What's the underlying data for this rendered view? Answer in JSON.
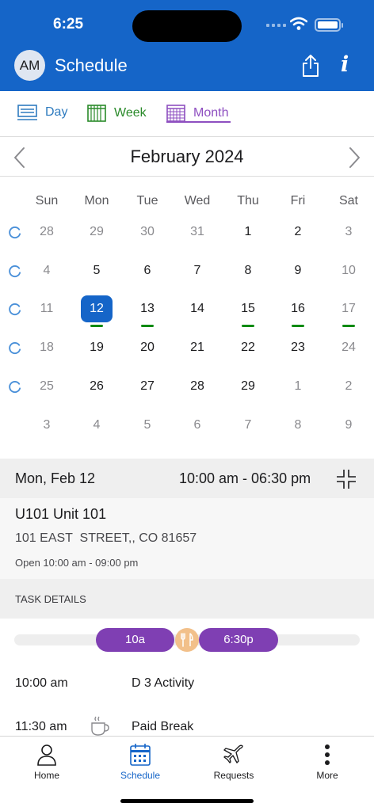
{
  "status_bar": {
    "time": "6:25"
  },
  "header": {
    "avatar_initials": "AM",
    "title": "Schedule"
  },
  "view_tabs": [
    {
      "label": "Day",
      "color": "#2e7bbf"
    },
    {
      "label": "Week",
      "color": "#2a8a2a"
    },
    {
      "label": "Month",
      "color": "#8e4fc0",
      "selected": true
    }
  ],
  "calendar": {
    "month_title": "February 2024",
    "weekdays": [
      "Sun",
      "Mon",
      "Tue",
      "Wed",
      "Thu",
      "Fri",
      "Sat"
    ],
    "weeks": [
      [
        {
          "d": "28",
          "dim": true
        },
        {
          "d": "29",
          "dim": true
        },
        {
          "d": "30",
          "dim": true
        },
        {
          "d": "31",
          "dim": true
        },
        {
          "d": "1"
        },
        {
          "d": "2"
        },
        {
          "d": "3",
          "dim": true
        }
      ],
      [
        {
          "d": "4",
          "dim": true
        },
        {
          "d": "5"
        },
        {
          "d": "6"
        },
        {
          "d": "7"
        },
        {
          "d": "8"
        },
        {
          "d": "9"
        },
        {
          "d": "10",
          "dim": true
        }
      ],
      [
        {
          "d": "11",
          "dim": true
        },
        {
          "d": "12",
          "selected": true,
          "shift": true
        },
        {
          "d": "13",
          "shift": true
        },
        {
          "d": "14"
        },
        {
          "d": "15",
          "shift": true
        },
        {
          "d": "16",
          "shift": true
        },
        {
          "d": "17",
          "dim": true,
          "shift": true
        }
      ],
      [
        {
          "d": "18",
          "dim": true
        },
        {
          "d": "19"
        },
        {
          "d": "20"
        },
        {
          "d": "21"
        },
        {
          "d": "22"
        },
        {
          "d": "23"
        },
        {
          "d": "24",
          "dim": true
        }
      ],
      [
        {
          "d": "25",
          "dim": true
        },
        {
          "d": "26"
        },
        {
          "d": "27"
        },
        {
          "d": "28"
        },
        {
          "d": "29"
        },
        {
          "d": "1",
          "dim": true
        },
        {
          "d": "2",
          "dim": true
        }
      ],
      [
        {
          "d": "3",
          "dim": true
        },
        {
          "d": "4",
          "dim": true
        },
        {
          "d": "5",
          "dim": true
        },
        {
          "d": "6",
          "dim": true
        },
        {
          "d": "7",
          "dim": true
        },
        {
          "d": "8",
          "dim": true
        },
        {
          "d": "9",
          "dim": true
        }
      ]
    ],
    "refresh_rows": 5,
    "selected_color": "#1565c8",
    "shift_marker_color": "#0b8a12"
  },
  "detail": {
    "date": "Mon, Feb 12",
    "time_range": "10:00 am - 06:30 pm",
    "unit_name": "U101  Unit 101",
    "address": "101 EAST  STREET,, CO 81657",
    "open_hours": "Open 10:00 am - 09:00 pm",
    "task_section_label": "TASK DETAILS",
    "timeline": {
      "start_label": "10a",
      "end_label": "6:30p",
      "color": "#7f3fb3"
    },
    "tasks": [
      {
        "time": "10:00 am",
        "name": "D 3 Activity",
        "icon": ""
      },
      {
        "time": "11:30 am",
        "name": "Paid Break",
        "icon": "coffee-cup-icon"
      }
    ]
  },
  "bottom_nav": [
    {
      "label": "Home",
      "icon": "person-icon"
    },
    {
      "label": "Schedule",
      "icon": "calendar-icon",
      "active": true
    },
    {
      "label": "Requests",
      "icon": "airplane-icon"
    },
    {
      "label": "More",
      "icon": "vertical-dots-icon"
    }
  ]
}
